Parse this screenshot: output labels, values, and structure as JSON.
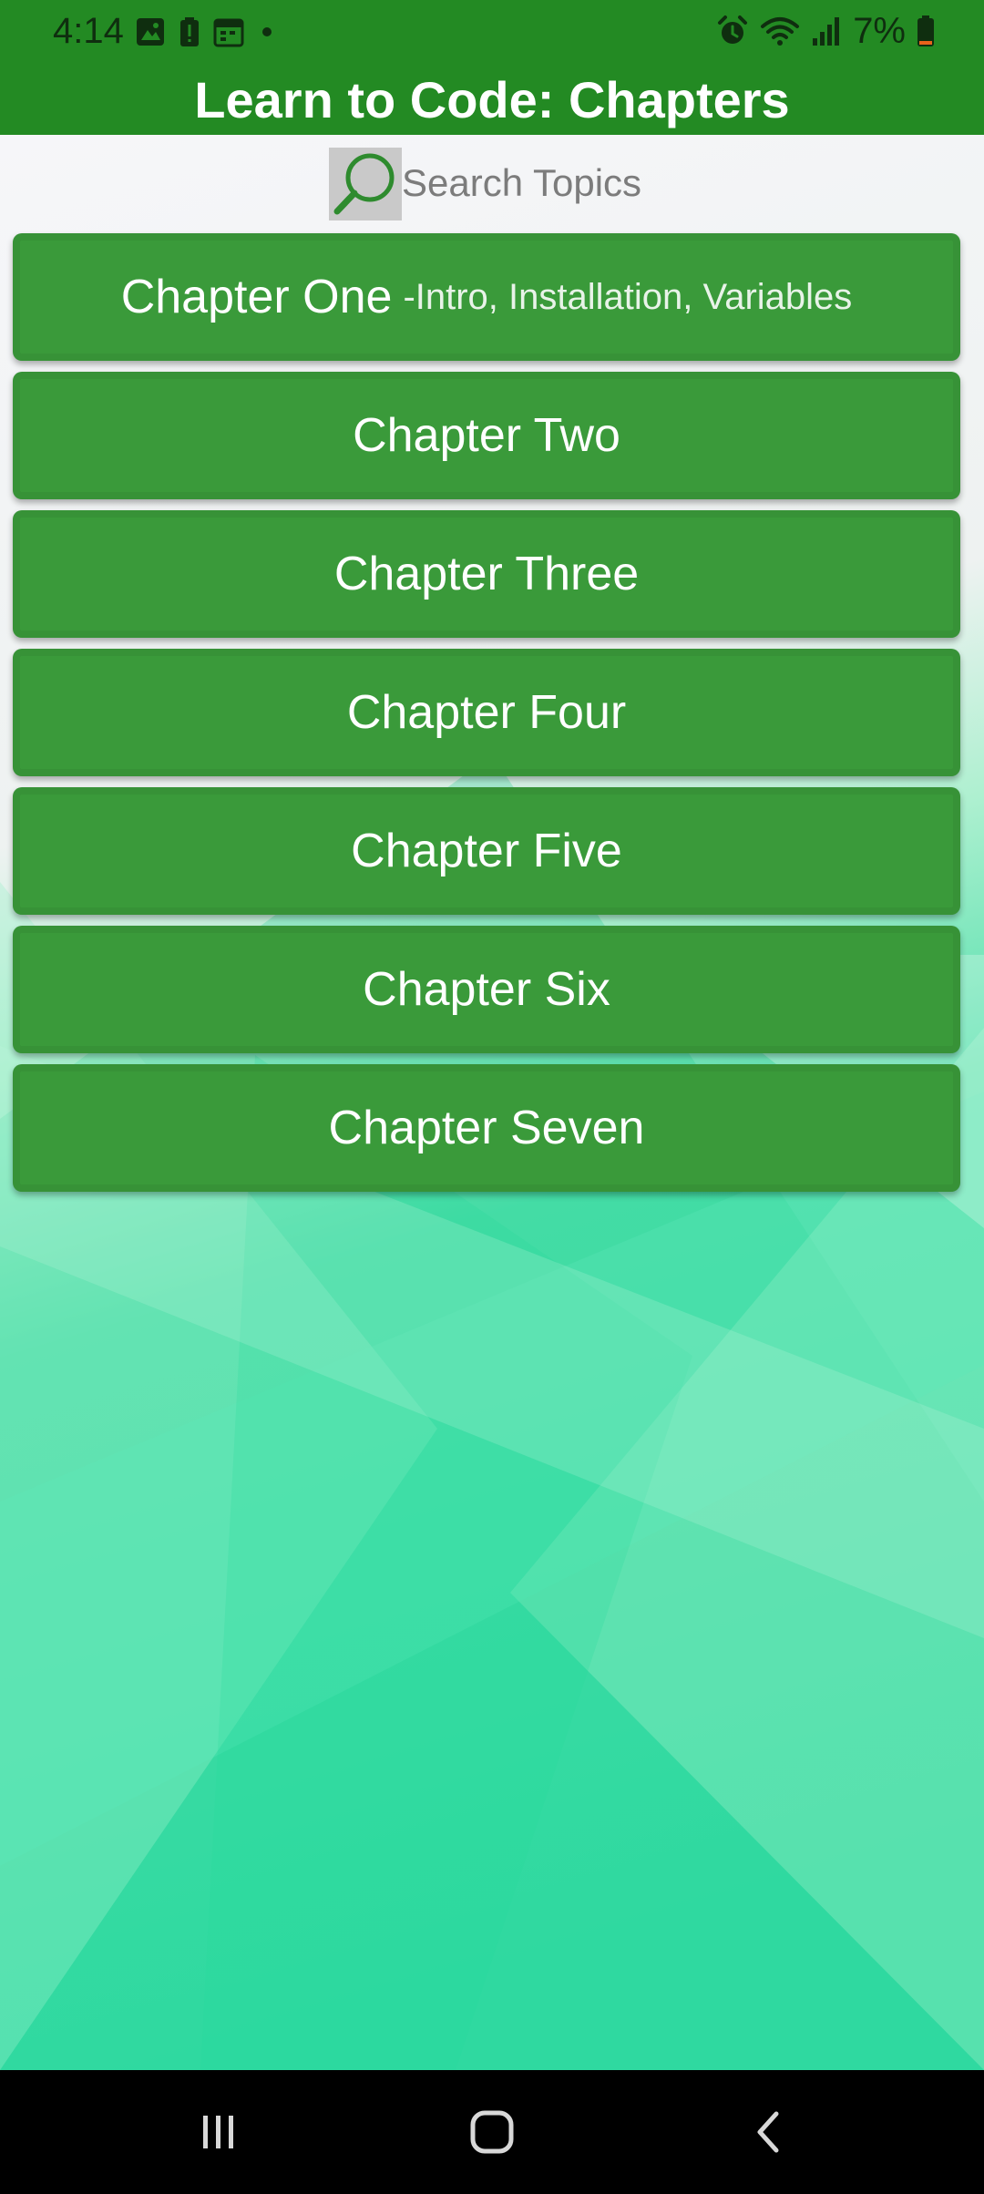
{
  "status_bar": {
    "time": "4:14",
    "battery_percent": "7%",
    "left_icons": [
      "gallery-icon",
      "battery-alert-icon",
      "calendar-icon",
      "notification-dot-icon"
    ],
    "right_icons": [
      "alarm-icon",
      "wifi-icon",
      "signal-icon",
      "battery-low-icon"
    ]
  },
  "header": {
    "title": "Learn to Code: Chapters"
  },
  "search": {
    "placeholder": "Search Topics",
    "icon": "search-icon"
  },
  "chapters": [
    {
      "label": "Chapter One",
      "subtitle": "-Intro, Installation, Variables"
    },
    {
      "label": "Chapter Two",
      "subtitle": ""
    },
    {
      "label": "Chapter Three",
      "subtitle": ""
    },
    {
      "label": "Chapter Four",
      "subtitle": ""
    },
    {
      "label": "Chapter Five",
      "subtitle": ""
    },
    {
      "label": "Chapter Six",
      "subtitle": ""
    },
    {
      "label": "Chapter Seven",
      "subtitle": ""
    }
  ],
  "nav_bar": {
    "items": [
      "recent-apps-icon",
      "home-icon",
      "back-icon"
    ]
  },
  "colors": {
    "primary": "#238a23",
    "chapter_button": "#3a9a3a",
    "text_light": "#ffffff",
    "search_icon_bg": "#c9c9c9",
    "search_icon_stroke": "#2e8b2e",
    "nav_bar": "#000000"
  }
}
